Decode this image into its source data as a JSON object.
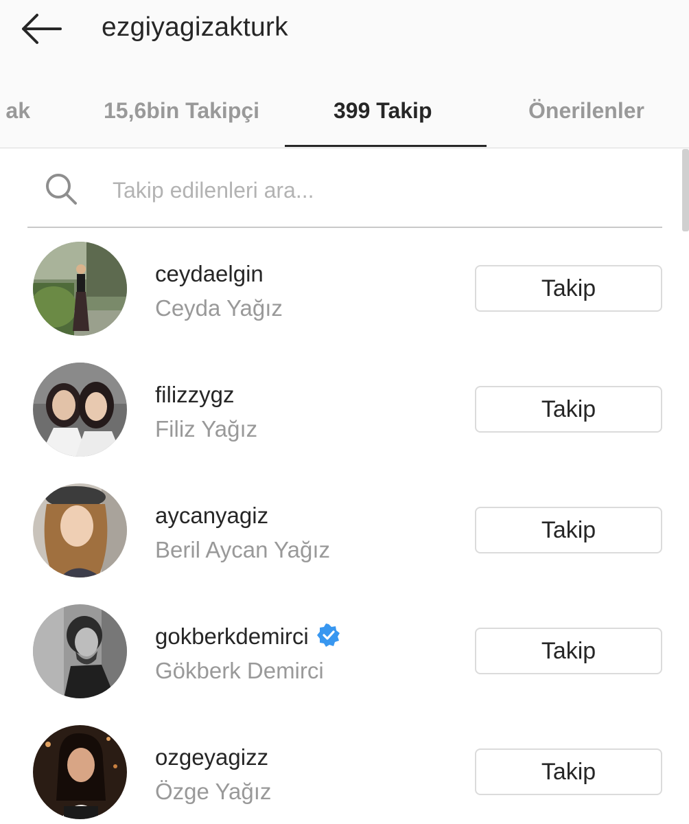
{
  "header": {
    "title": "ezgiyagizakturk"
  },
  "tabs": [
    {
      "label": "ak",
      "state": "inactive"
    },
    {
      "label": "15,6bin Takipçi",
      "state": "inactive"
    },
    {
      "label": "399 Takip",
      "state": "active"
    },
    {
      "label": "Önerilenler",
      "state": "inactive"
    }
  ],
  "search": {
    "placeholder": "Takip edilenleri ara..."
  },
  "following": [
    {
      "username": "ceydaelgin",
      "fullname": "Ceyda Yağız",
      "button_label": "Takip",
      "verified": false
    },
    {
      "username": "filizzygz",
      "fullname": "Filiz Yağız",
      "button_label": "Takip",
      "verified": false
    },
    {
      "username": "aycanyagiz",
      "fullname": "Beril Aycan Yağız",
      "button_label": "Takip",
      "verified": false
    },
    {
      "username": "gokberkdemirci",
      "fullname": "Gökberk Demirci",
      "button_label": "Takip",
      "verified": true
    },
    {
      "username": "ozgeyagizz",
      "fullname": "Özge Yağız",
      "button_label": "Takip",
      "verified": false
    }
  ],
  "icons": {
    "back": "arrow-left-icon",
    "search": "magnifier-icon",
    "verified": "verified-badge-icon"
  },
  "colors": {
    "verified_badge": "#3897f0",
    "primary_text": "#262626",
    "secondary_text": "#999999"
  }
}
